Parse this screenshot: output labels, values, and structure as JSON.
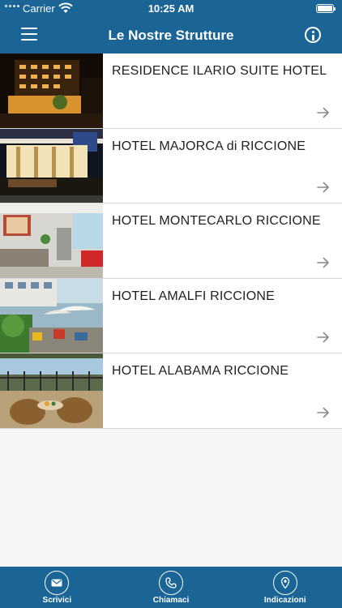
{
  "status_bar": {
    "carrier": "Carrier",
    "time": "10:25 AM"
  },
  "nav": {
    "title": "Le Nostre Strutture",
    "menu_icon": "hamburger-menu-icon",
    "info_icon": "info-icon"
  },
  "hotels": [
    {
      "name": "RESIDENCE ILARIO SUITE HOTEL",
      "photo": "night-street-hotel-facade"
    },
    {
      "name": "HOTEL MAJORCA di RICCIONE",
      "photo": "hotel-front-terrace-evening"
    },
    {
      "name": "HOTEL MONTECARLO RICCIONE",
      "photo": "hotel-lobby-interior"
    },
    {
      "name": "HOTEL AMALFI RICCIONE",
      "photo": "garden-patio-with-umbrellas"
    },
    {
      "name": "HOTEL ALABAMA RICCIONE",
      "photo": "balcony-wicker-chairs"
    }
  ],
  "tab_bar": {
    "tabs": [
      {
        "label": "Scrivici",
        "icon": "envelope-icon"
      },
      {
        "label": "Chiamaci",
        "icon": "phone-icon"
      },
      {
        "label": "Indicazioni",
        "icon": "map-pin-icon"
      }
    ]
  },
  "colors": {
    "primary": "#1a6496",
    "row_bg": "#ffffff",
    "page_bg": "#f5f5f5",
    "separator": "#d6d6d6",
    "arrow": "#8a8a8a"
  }
}
